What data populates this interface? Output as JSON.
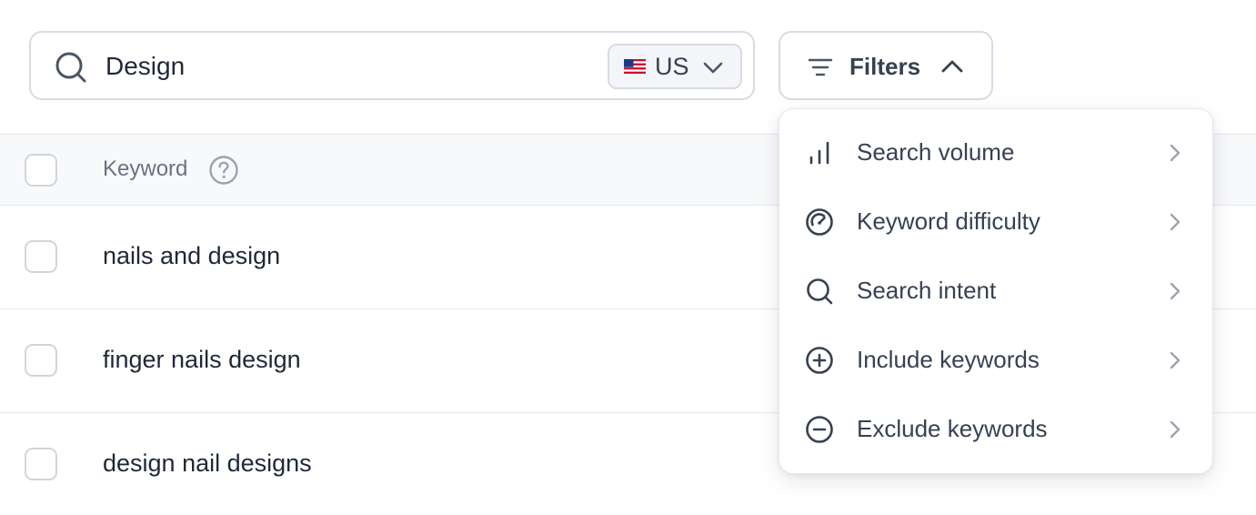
{
  "search": {
    "value": "Design",
    "icon": "search-icon"
  },
  "country": {
    "selected": "US",
    "flag_icon": "us-flag-icon"
  },
  "filters": {
    "label": "Filters",
    "expanded": true
  },
  "table": {
    "header": {
      "keyword_label": "Keyword"
    },
    "rows": [
      {
        "keyword": "nails and design"
      },
      {
        "keyword": "finger nails design"
      },
      {
        "keyword": "design nail designs"
      }
    ]
  },
  "filter_menu": {
    "items": [
      {
        "label": "Search volume",
        "icon": "bar-chart-icon"
      },
      {
        "label": "Keyword difficulty",
        "icon": "gauge-icon"
      },
      {
        "label": "Search intent",
        "icon": "search-icon"
      },
      {
        "label": "Include keywords",
        "icon": "plus-circle-icon"
      },
      {
        "label": "Exclude keywords",
        "icon": "minus-circle-icon"
      }
    ]
  },
  "colors": {
    "border": "#d7dbe2",
    "text": "#1f2937",
    "muted": "#6b7280",
    "header_bg": "#f8f9fb"
  }
}
